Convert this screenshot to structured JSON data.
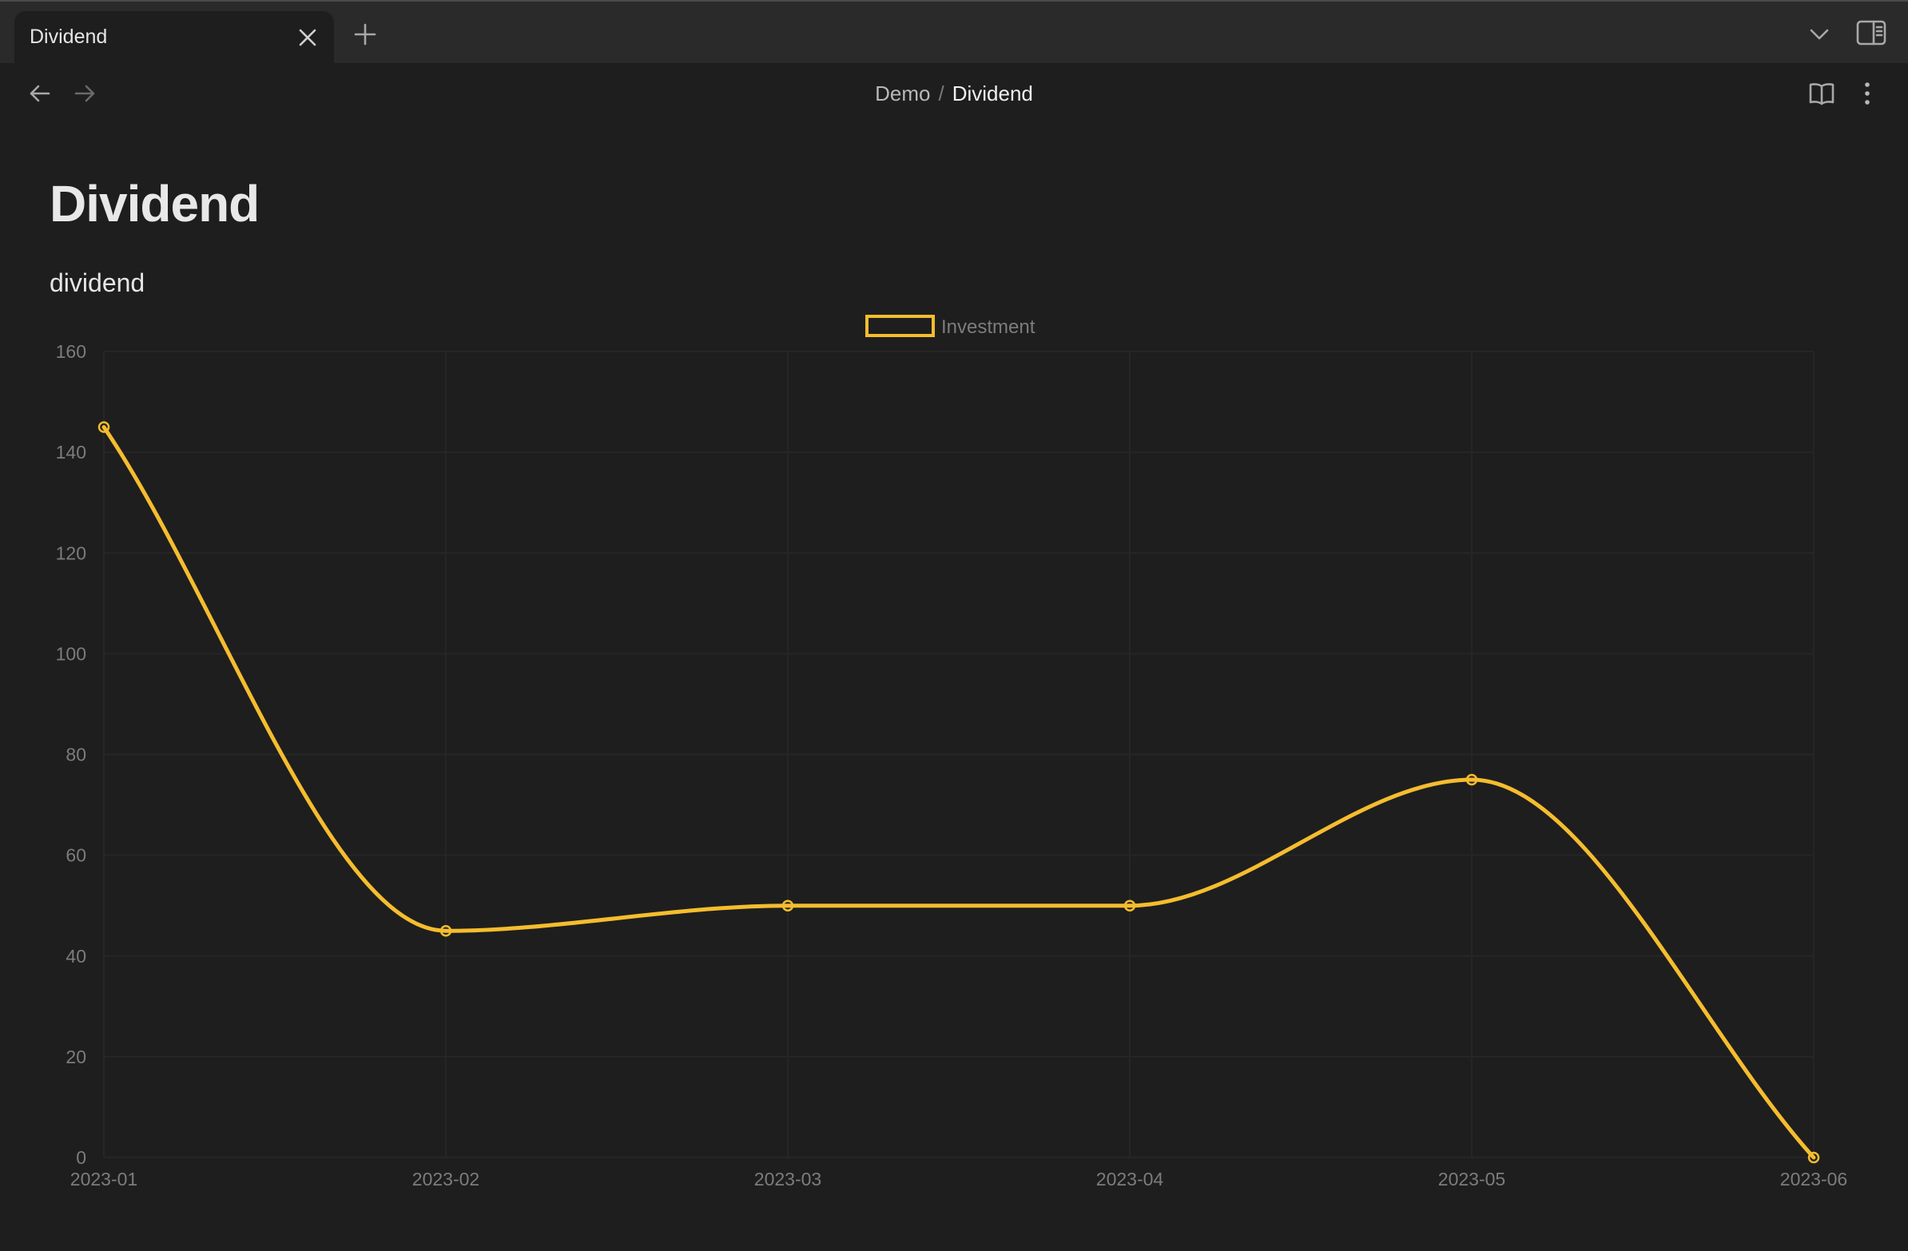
{
  "tabs": [
    {
      "title": "Dividend",
      "active": true
    }
  ],
  "breadcrumb": {
    "parent": "Demo",
    "separator": "/",
    "current": "Dividend"
  },
  "page": {
    "title": "Dividend",
    "text": "dividend"
  },
  "colors": {
    "background": "#1e1e1e",
    "tabbar": "#2a2a2a",
    "series": "#f5bd2e",
    "gridline": "#262626",
    "tick_text": "#7c7c7c"
  },
  "icons": {
    "tab_close": "close-icon",
    "new_tab": "plus-icon",
    "tab_list": "chevron-down-icon",
    "sidebar": "sidebar-right-icon",
    "back": "arrow-left-icon",
    "forward": "arrow-right-icon",
    "reading": "book-open-icon",
    "more": "more-vertical-icon"
  },
  "chart_data": {
    "type": "line",
    "x": [
      "2023-01",
      "2023-02",
      "2023-03",
      "2023-04",
      "2023-05",
      "2023-06"
    ],
    "series": [
      {
        "name": "Investment",
        "values": [
          145,
          45,
          50,
          50,
          75,
          0
        ],
        "color": "#f5bd2e"
      }
    ],
    "ylim": [
      0,
      160
    ],
    "yticks": [
      0,
      20,
      40,
      60,
      80,
      100,
      120,
      140,
      160
    ],
    "legend": "top-center",
    "grid": true,
    "smooth": true
  }
}
